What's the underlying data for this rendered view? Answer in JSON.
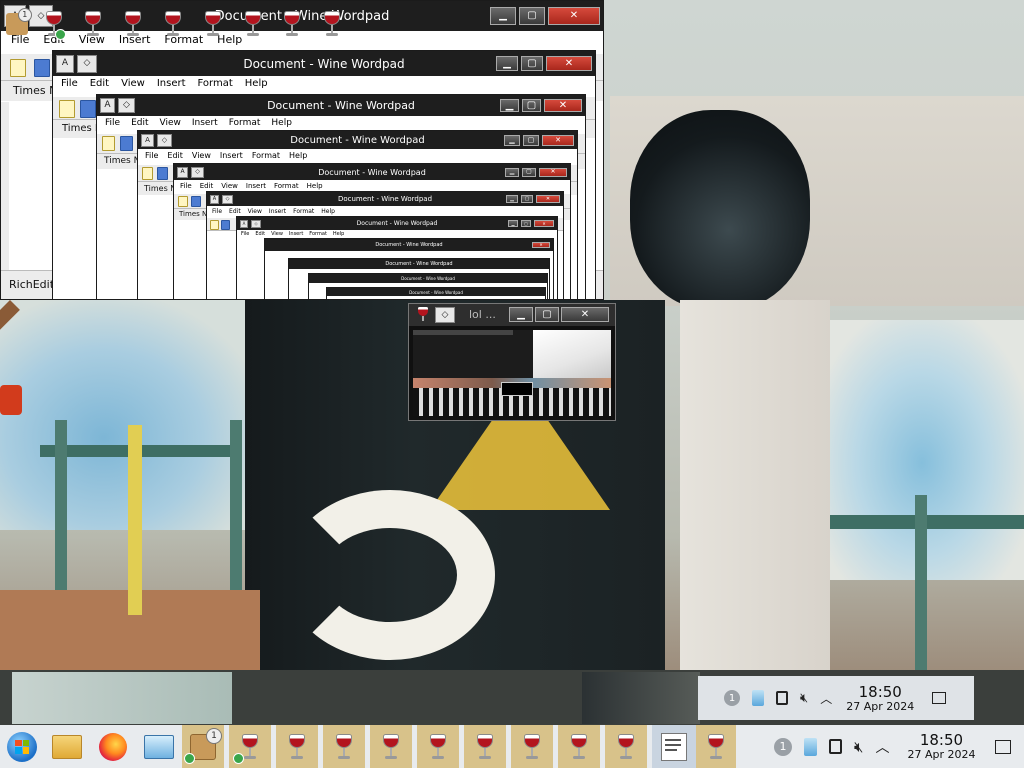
{
  "wallpaper": {
    "description_tag": "photo-wallpaper"
  },
  "wordpad": {
    "title": "Document - Wine Wordpad",
    "menu": [
      "File",
      "Edit",
      "View",
      "Insert",
      "Format",
      "Help"
    ],
    "font_name": "Times N",
    "font_name_small": "Times New",
    "status": "RichEdit",
    "status_small": "RichEdit"
  },
  "thumbnail": {
    "title": "lol ..."
  },
  "taskbar": {
    "clock_time": "18:50",
    "clock_date": "27 Apr 2024",
    "badge": "1"
  },
  "taskbar_mini": {
    "clock_time": "18:50",
    "clock_date": "27 Apr 2024",
    "badge": "1"
  },
  "colors": {
    "titlebar": "#1e1e1e",
    "close": "#c43325",
    "wine_red": "#b3141e",
    "taskbar": "#e8ebee",
    "taskbar_tan": "#d8c28a"
  }
}
